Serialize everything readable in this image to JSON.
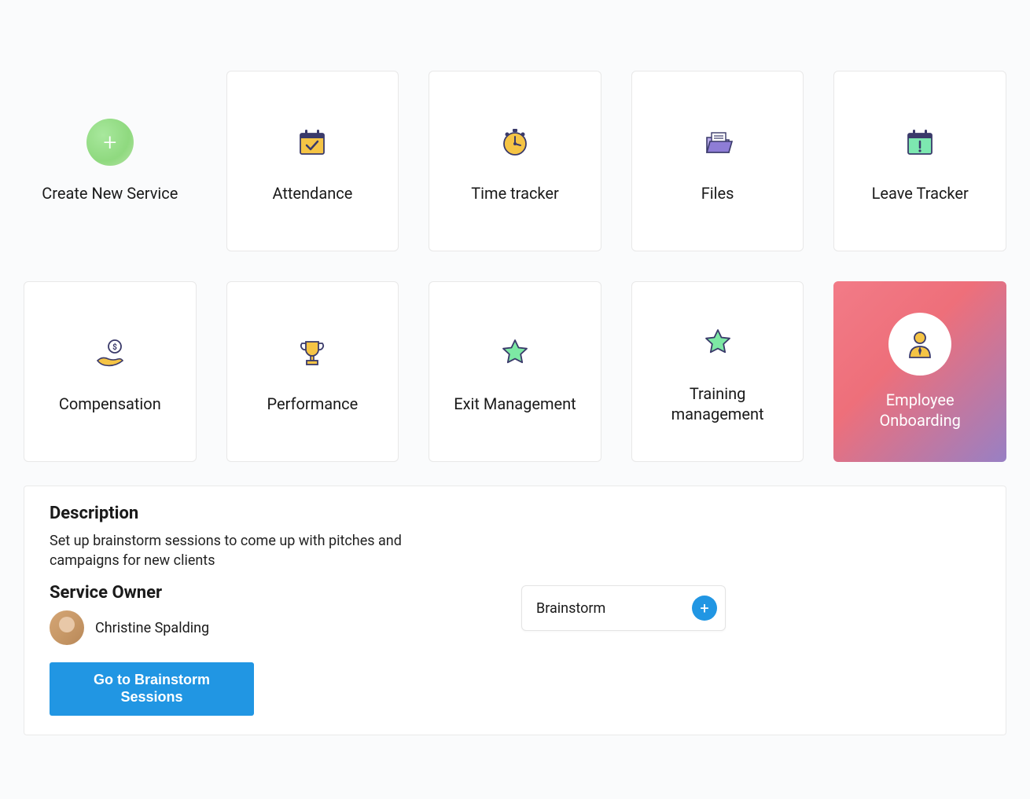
{
  "create_new": {
    "label": "Create New Service"
  },
  "cards": [
    {
      "label": "Attendance"
    },
    {
      "label": "Time tracker"
    },
    {
      "label": "Files"
    },
    {
      "label": "Leave Tracker"
    },
    {
      "label": "Compensation"
    },
    {
      "label": "Performance"
    },
    {
      "label": "Exit Management"
    },
    {
      "label": "Training management"
    },
    {
      "label": "Employee Onboarding"
    }
  ],
  "detail": {
    "description_heading": "Description",
    "description_text": "Set up brainstorm sessions to come up with pitches and campaigns for new clients",
    "owner_heading": "Service Owner",
    "owner_name": "Christine Spalding",
    "cta": "Go to Brainstorm Sessions",
    "chip_label": "Brainstorm"
  }
}
